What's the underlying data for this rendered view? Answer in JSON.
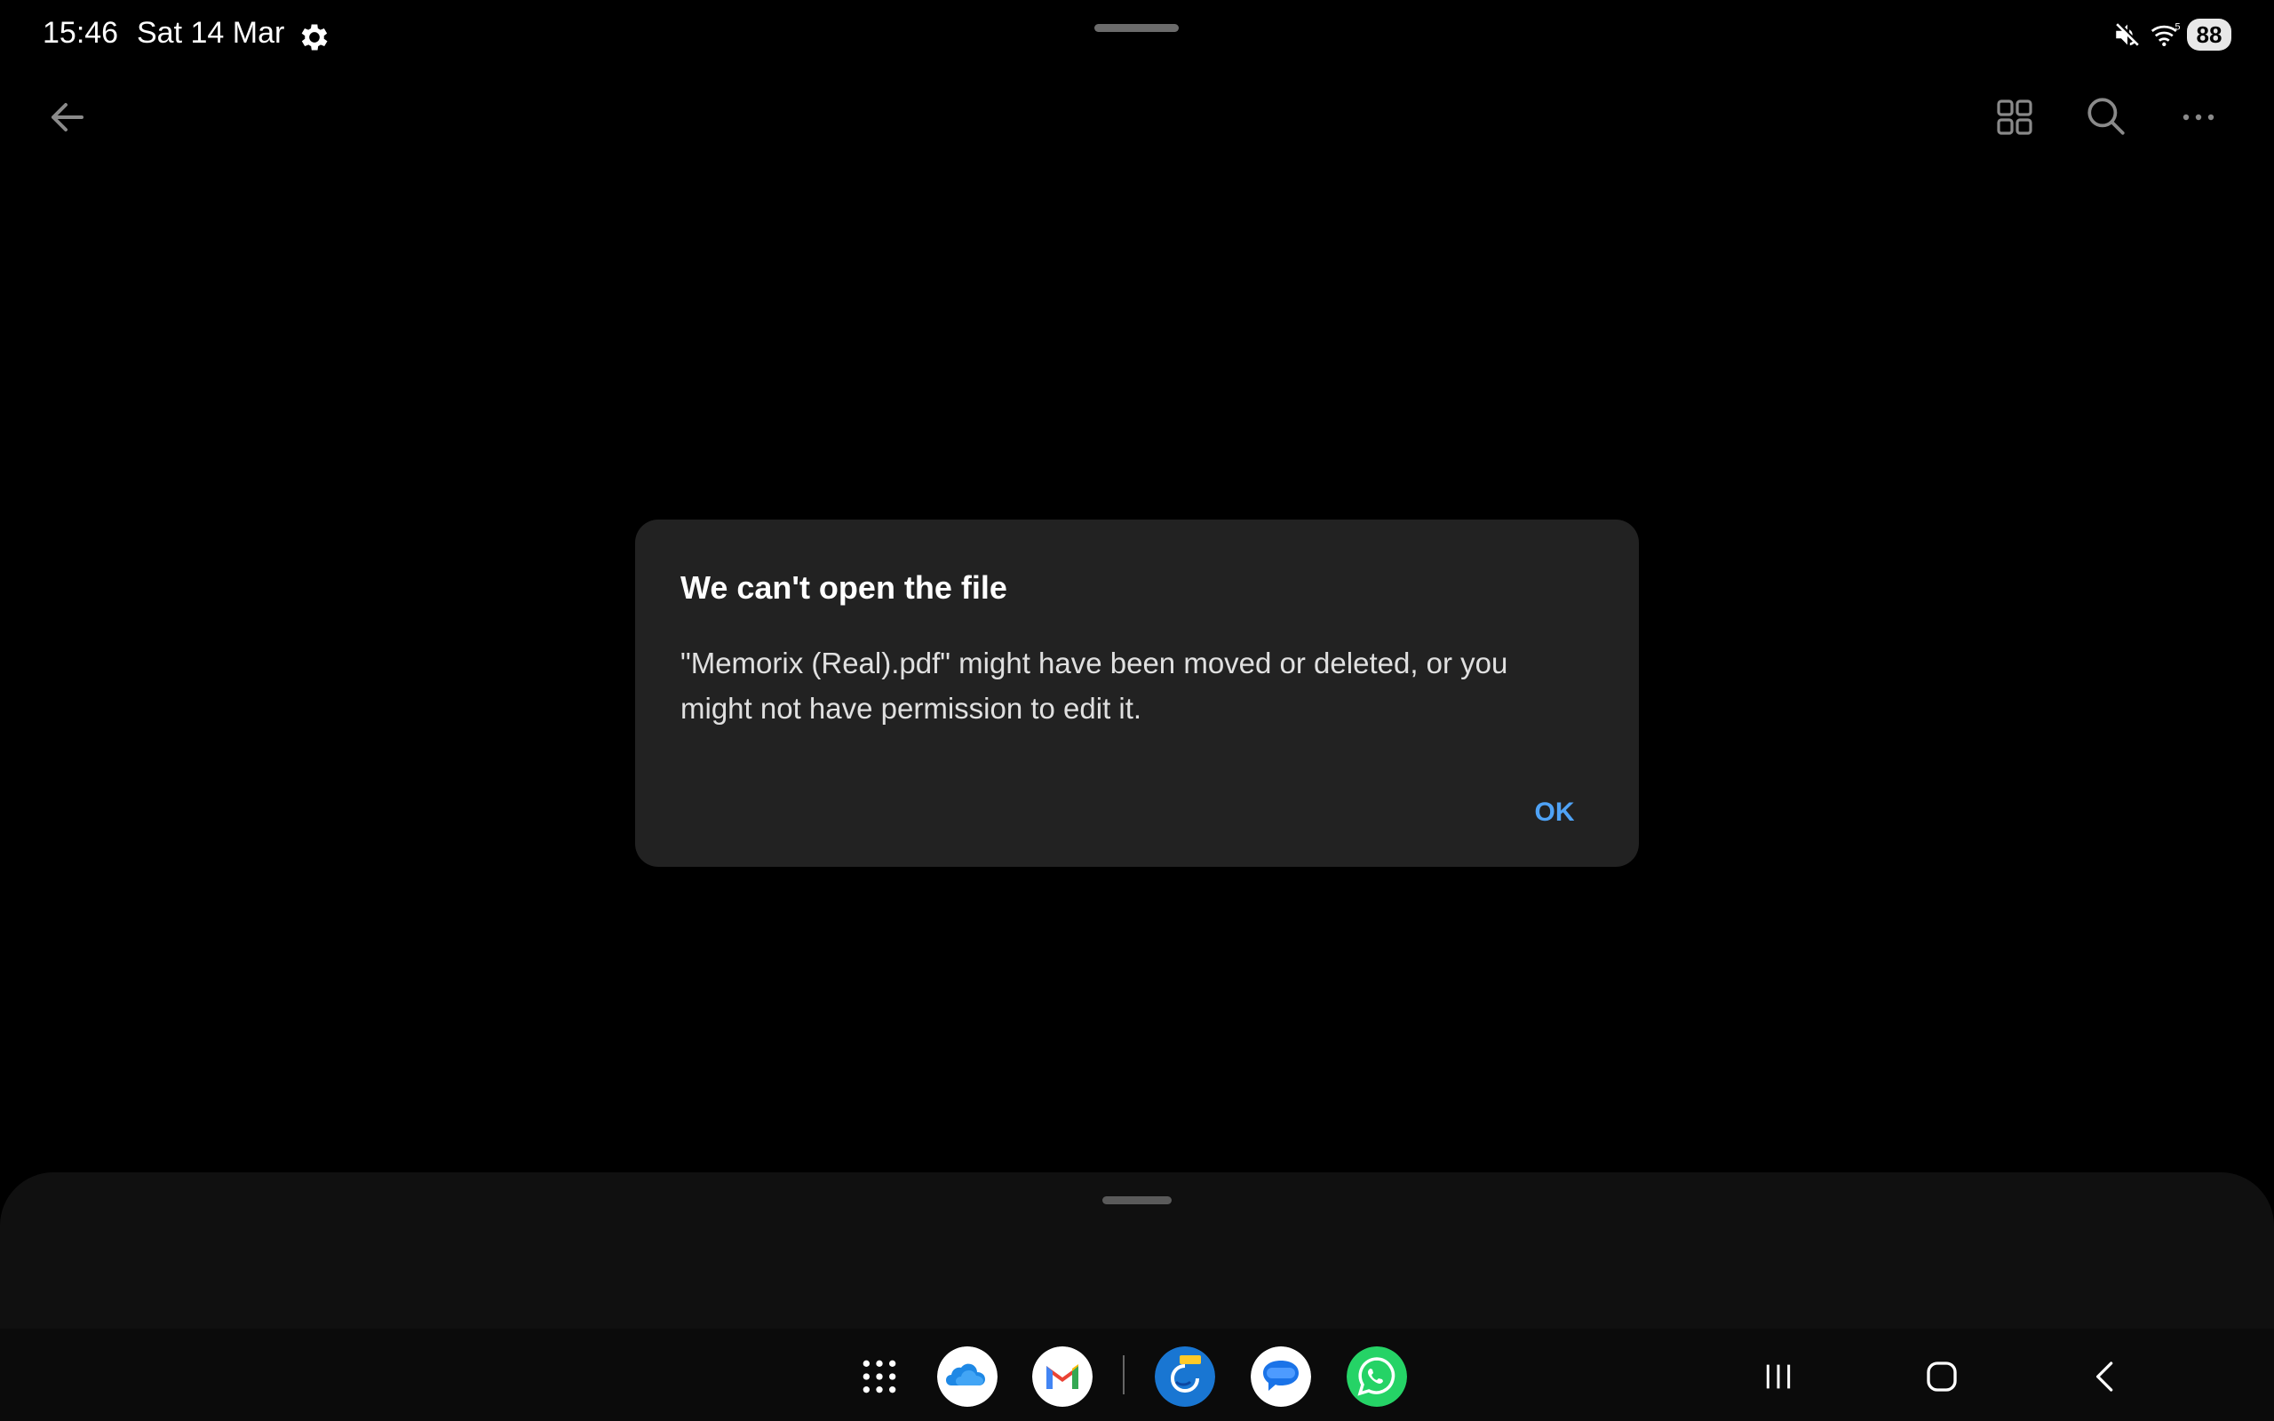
{
  "status_bar": {
    "time": "15:46",
    "date": "Sat 14 Mar",
    "battery": "88",
    "icons": [
      "settings-gear-icon",
      "mute-icon",
      "wifi-icon"
    ]
  },
  "app_bar": {
    "icons": [
      "back-arrow-icon",
      "grid-view-icon",
      "search-icon",
      "more-options-icon"
    ]
  },
  "dialog": {
    "title": "We can't open the file",
    "message": "\"Memorix (Real).pdf\" might have been moved or deleted, or you might not have permission to edit it.",
    "ok_label": "OK"
  },
  "dock": {
    "apps": [
      "onedrive",
      "gmail",
      "finder-app",
      "messages",
      "whatsapp"
    ],
    "icons": [
      "apps-grid-icon"
    ]
  },
  "nav_bar": {
    "icons": [
      "recents-icon",
      "home-icon",
      "back-icon"
    ]
  },
  "colors": {
    "background": "#000000",
    "dialog_bg": "#222222",
    "accent": "#4fa3f7",
    "whatsapp": "#25d366",
    "messages": "#1a73e8"
  }
}
